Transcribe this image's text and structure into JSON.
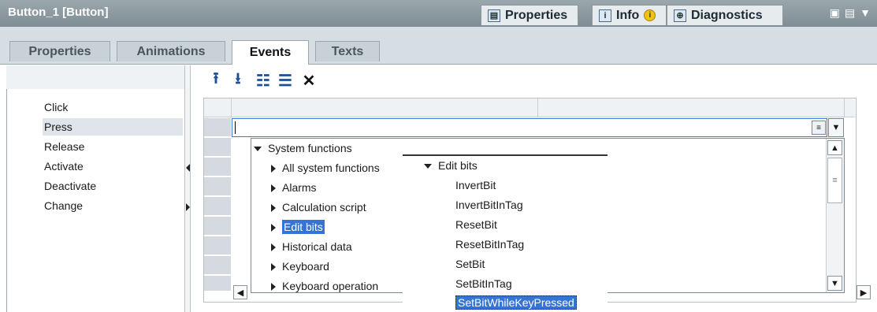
{
  "window": {
    "title": "Button_1 [Button]"
  },
  "inspector_tabs": [
    {
      "label": "Properties",
      "icon": "properties-icon"
    },
    {
      "label": "Info",
      "icon": "info-icon",
      "badge": "i"
    },
    {
      "label": "Diagnostics",
      "icon": "diagnostics-icon"
    }
  ],
  "window_controls": [
    "restore-icon",
    "menu-icon",
    "dropdown-icon"
  ],
  "tabs": [
    {
      "label": "Properties",
      "active": false
    },
    {
      "label": "Animations",
      "active": false
    },
    {
      "label": "Events",
      "active": true
    },
    {
      "label": "Texts",
      "active": false
    }
  ],
  "events": [
    {
      "label": "Click",
      "selected": false
    },
    {
      "label": "Press",
      "selected": true
    },
    {
      "label": "Release",
      "selected": false
    },
    {
      "label": "Activate",
      "selected": false
    },
    {
      "label": "Deactivate",
      "selected": false
    },
    {
      "label": "Change",
      "selected": false
    }
  ],
  "toolbar": [
    "move-up-icon",
    "move-down-icon",
    "expand-icon",
    "list-icon",
    "delete-icon"
  ],
  "function_list": {
    "input_value": "",
    "root": "System functions",
    "items": [
      {
        "label": "All system functions",
        "selected": false
      },
      {
        "label": "Alarms",
        "selected": false
      },
      {
        "label": "Calculation script",
        "selected": false
      },
      {
        "label": "Edit bits",
        "selected": true
      },
      {
        "label": "Historical data",
        "selected": false
      },
      {
        "label": "Keyboard",
        "selected": false
      },
      {
        "label": "Keyboard operation",
        "selected": false
      }
    ]
  },
  "submenu": {
    "title": "Edit bits",
    "items": [
      {
        "label": "InvertBit",
        "selected": false
      },
      {
        "label": "InvertBitInTag",
        "selected": false
      },
      {
        "label": "ResetBit",
        "selected": false
      },
      {
        "label": "ResetBitInTag",
        "selected": false
      },
      {
        "label": "SetBit",
        "selected": false
      },
      {
        "label": "SetBitInTag",
        "selected": false
      },
      {
        "label": "SetBitWhileKeyPressed",
        "selected": true
      }
    ]
  },
  "colors": {
    "titlebar": "#8b989e",
    "selection": "#3574d4",
    "accent": "#1d4f92"
  }
}
